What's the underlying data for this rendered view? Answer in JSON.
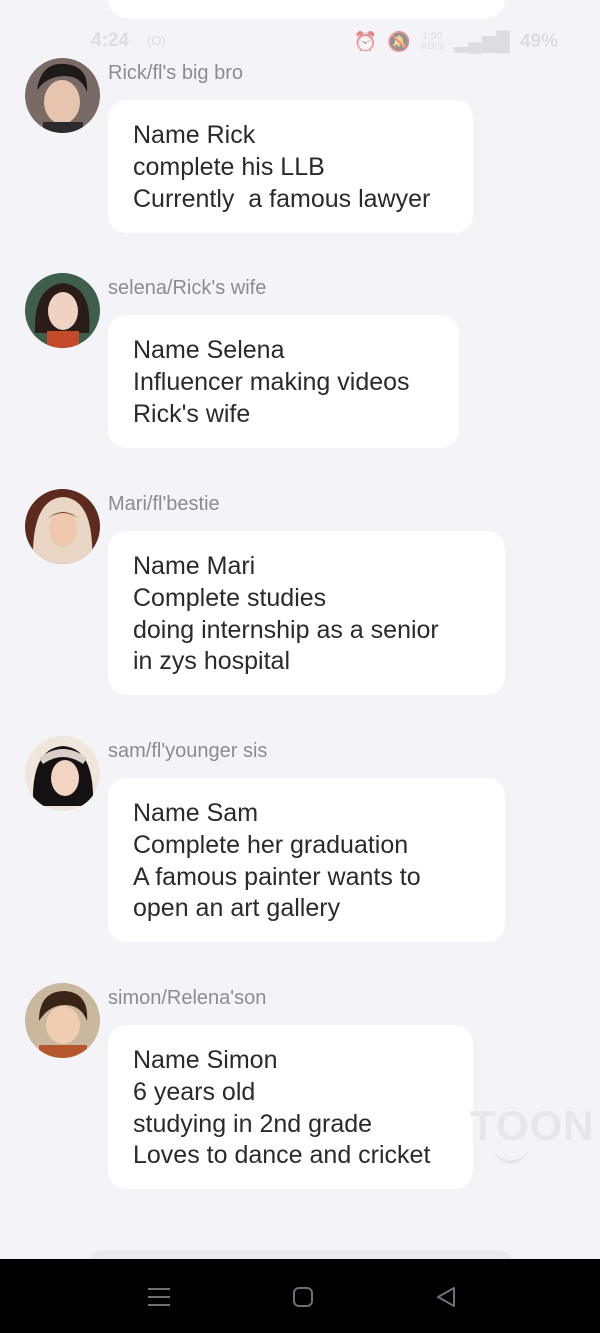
{
  "status_bar": {
    "time": "4:24",
    "sim_label": "(O)",
    "speed_top": "1.00",
    "speed_bottom": "KB/S",
    "battery": "49%"
  },
  "messages": [
    {
      "sender": "Rick/fl's big bro",
      "avatar": "avatar-rick",
      "lines": [
        "Name Rick",
        "complete his LLB",
        "Currently  a famous lawyer"
      ]
    },
    {
      "sender": "selena/Rick's wife",
      "avatar": "avatar-selena",
      "lines": [
        "Name Selena",
        "Influencer making videos",
        "Rick's wife"
      ]
    },
    {
      "sender": "Mari/fl'bestie",
      "avatar": "avatar-mari",
      "lines": [
        "Name Mari",
        "Complete studies",
        "doing internship as a senior",
        "in zys hospital"
      ]
    },
    {
      "sender": "sam/fl'younger sis",
      "avatar": "avatar-sam",
      "lines": [
        "Name Sam",
        "Complete her graduation",
        "A famous painter wants to",
        "open an art gallery"
      ]
    },
    {
      "sender": "simon/Relena'son",
      "avatar": "avatar-simon",
      "lines": [
        "Name Simon",
        "6 years old",
        "studying in 2nd grade",
        "Loves to dance and cricket"
      ]
    }
  ],
  "watermark": "TOON",
  "nav": {
    "recents": "menu-icon",
    "home": "home-icon",
    "back": "back-icon"
  }
}
